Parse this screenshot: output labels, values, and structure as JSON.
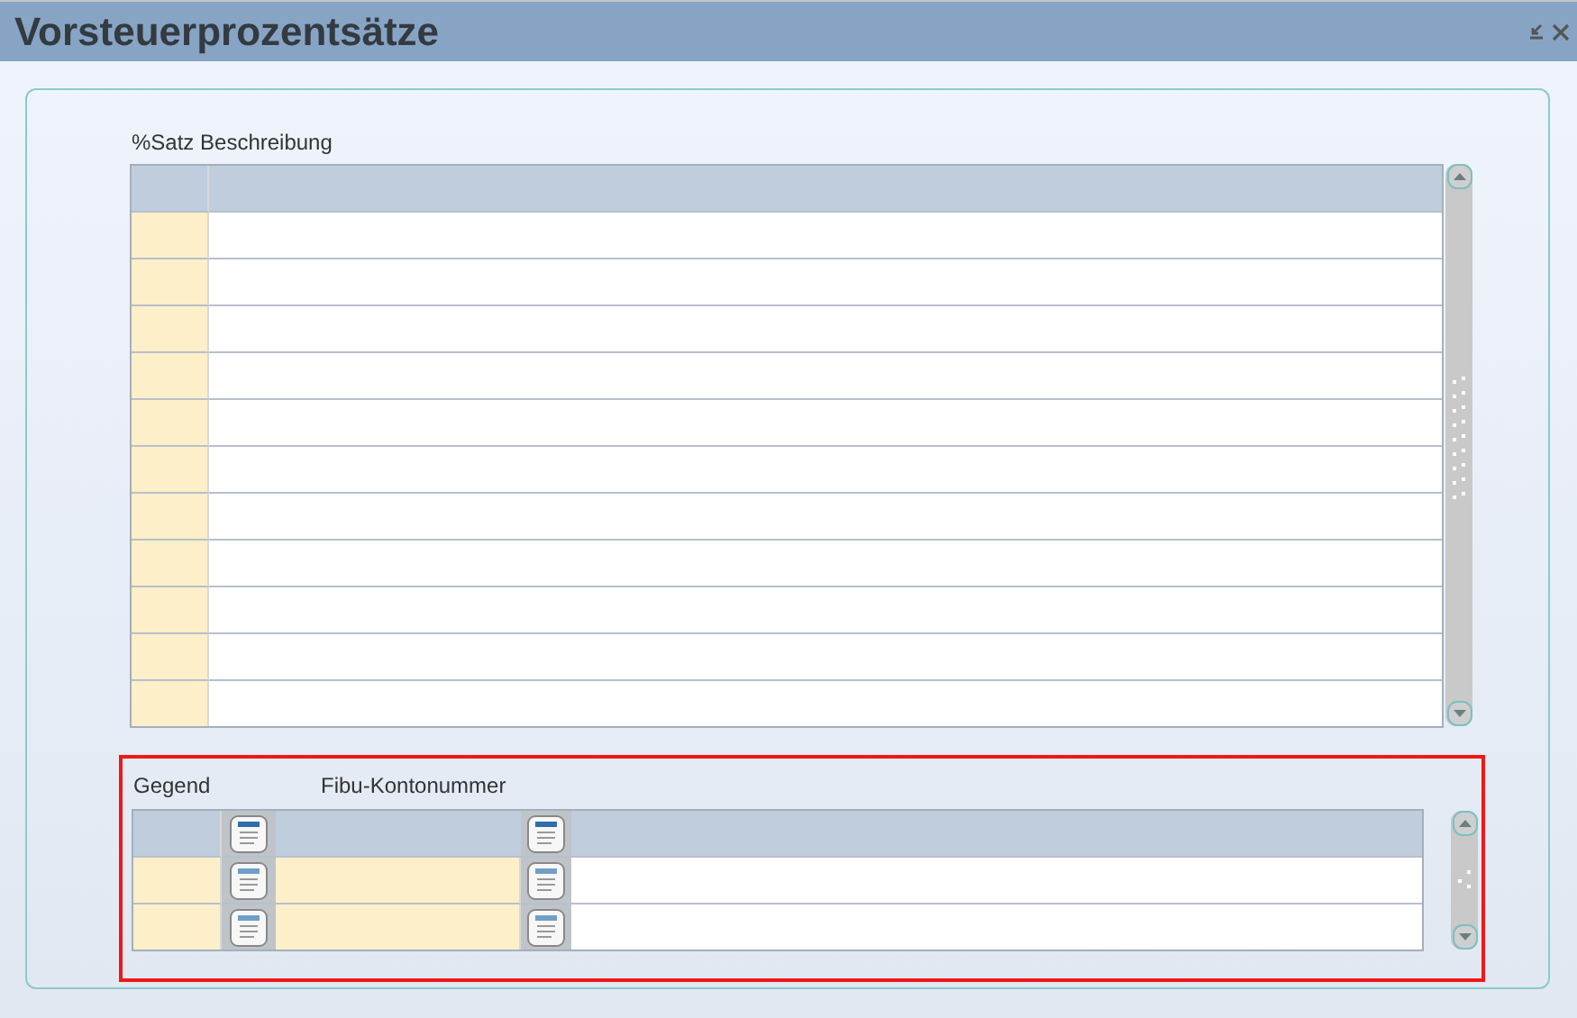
{
  "window": {
    "title": "Vorsteuerprozentsätze"
  },
  "upper_table": {
    "caption": "%Satz Beschreibung"
  },
  "lower_table": {
    "highlighted": true,
    "columns": [
      {
        "label": "Gegend"
      },
      {
        "label": "Fibu-Kontonummer"
      }
    ]
  }
}
